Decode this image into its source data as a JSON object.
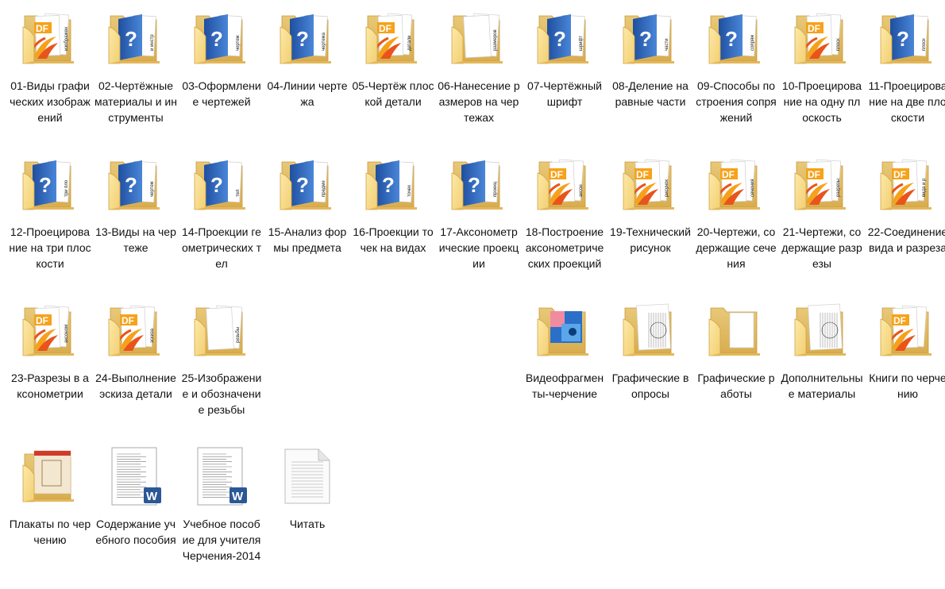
{
  "items": [
    {
      "label": "01-Виды графических изображений",
      "icon": "folder-pdf-icon",
      "preview": "изображен"
    },
    {
      "label": "02-Чертёжные материалы и инструменты",
      "icon": "folder-help-icon",
      "preview": "и инстр",
      "clamp": true
    },
    {
      "label": "03-Оформление чертежей",
      "icon": "folder-help-icon",
      "preview": "чертеж"
    },
    {
      "label": "04-Линии чертежа",
      "icon": "folder-help-icon",
      "preview": "чертежа"
    },
    {
      "label": "05-Чертёж плоской детали",
      "icon": "folder-pdf-icon",
      "preview": "детали"
    },
    {
      "label": "06-Нанесение размеров на чертежах",
      "icon": "folder-doc-icon",
      "preview": "размеров"
    },
    {
      "label": "07-Чертёжный шрифт",
      "icon": "folder-help-icon",
      "preview": "шрифт"
    },
    {
      "label": "08-Деление на равные части",
      "icon": "folder-help-icon",
      "preview": "части"
    },
    {
      "label": "09-Способы построения сопряжений",
      "icon": "folder-help-icon",
      "preview": "сопряж"
    },
    {
      "label": "10-Проецирование на одну плоскость",
      "icon": "folder-pdf-icon",
      "preview": "плоск"
    },
    {
      "label": "11-Проецирование на две плоскости",
      "icon": "folder-help-icon",
      "preview": "плоск"
    },
    {
      "label": "12-Проецирование на три плоскости",
      "icon": "folder-help-icon",
      "preview": "три пло"
    },
    {
      "label": "13-Виды на чертеже",
      "icon": "folder-help-icon",
      "preview": "чертеж"
    },
    {
      "label": "14-Проекции геометрических тел",
      "icon": "folder-help-icon",
      "preview": "тел"
    },
    {
      "label": "15-Анализ формы предмета",
      "icon": "folder-help-icon",
      "preview": "предме"
    },
    {
      "label": "16-Проекции точек на видах",
      "icon": "folder-help-icon",
      "preview": "точек"
    },
    {
      "label": "17-Аксонометрические проекции",
      "icon": "folder-help-icon",
      "preview": "проекц"
    },
    {
      "label": "18-Построение аксонометрических проекций",
      "icon": "folder-pdf-icon",
      "preview": "аксон",
      "clamp": true
    },
    {
      "label": "19-Технический рисунок",
      "icon": "folder-pdf-icon",
      "preview": "рисунок"
    },
    {
      "label": "20-Чертежи, содержащие сечения",
      "icon": "folder-pdf-icon",
      "preview": "сечения"
    },
    {
      "label": "21-Чертежи, содержащие разрезы",
      "icon": "folder-pdf-icon",
      "preview": "разрезы"
    },
    {
      "label": "22-Соединение вида и разреза",
      "icon": "folder-pdf-icon",
      "preview": "вида и р"
    },
    {
      "label": "23-Разрезы в аксонометрии",
      "icon": "folder-pdf-icon",
      "preview": "аксоном"
    },
    {
      "label": "24-Выполнение эскиза детали",
      "icon": "folder-pdf-icon",
      "preview": "эскиза"
    },
    {
      "label": "25-Изображение и обозначение резьбы",
      "icon": "folder-doc-icon",
      "preview": "резьбы"
    },
    {
      "label": "Видеофрагменты-черчение",
      "icon": "folder-video-icon",
      "preview": ""
    },
    {
      "label": "Графические вопросы",
      "icon": "folder-drawing-icon",
      "preview": ""
    },
    {
      "label": "Графические работы",
      "icon": "folder-empty-icon",
      "preview": ""
    },
    {
      "label": "Дополнительные материалы",
      "icon": "folder-drawing-icon",
      "preview": ""
    },
    {
      "label": "Книги по черчению",
      "icon": "folder-pdf-icon",
      "preview": ""
    },
    {
      "label": "Плакаты по черчению",
      "icon": "folder-poster-icon",
      "preview": ""
    },
    {
      "label": "Содержание учебного пособия",
      "icon": "word-document-icon",
      "preview": ""
    },
    {
      "label": "Учебное пособие для учителя Черчения-2014",
      "icon": "word-document-icon",
      "preview": "",
      "clamp": true
    },
    {
      "label": "Читать",
      "icon": "text-document-icon",
      "preview": ""
    }
  ]
}
